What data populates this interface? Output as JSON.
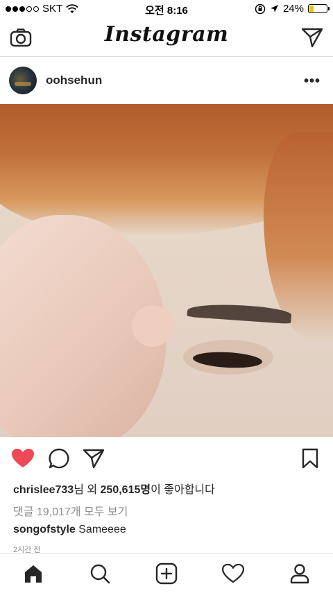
{
  "status_bar": {
    "carrier": "SKT",
    "time": "오전 8:16",
    "battery": "24%",
    "battery_level": 0.24,
    "battery_color": "#f4c20d"
  },
  "header": {
    "logo": "Instagram",
    "left_icon": "camera-icon",
    "right_icon": "direct-send-icon"
  },
  "post": {
    "username": "oohsehun",
    "more_label": "•••",
    "liked": true,
    "like_color": "#ed4956",
    "likes_user": "chrislee733",
    "likes_mid": "님 외 ",
    "likes_count": "250,615명",
    "likes_suffix": "이 좋아합니다",
    "comments_link": "댓글 19,017개 모두 보기",
    "comment": {
      "user": "songofstyle",
      "text": "Sameeee"
    },
    "timestamp": "2시간 전"
  },
  "tabbar": {
    "items": [
      "home-icon",
      "search-icon",
      "add-icon",
      "heart-icon",
      "profile-icon"
    ]
  }
}
